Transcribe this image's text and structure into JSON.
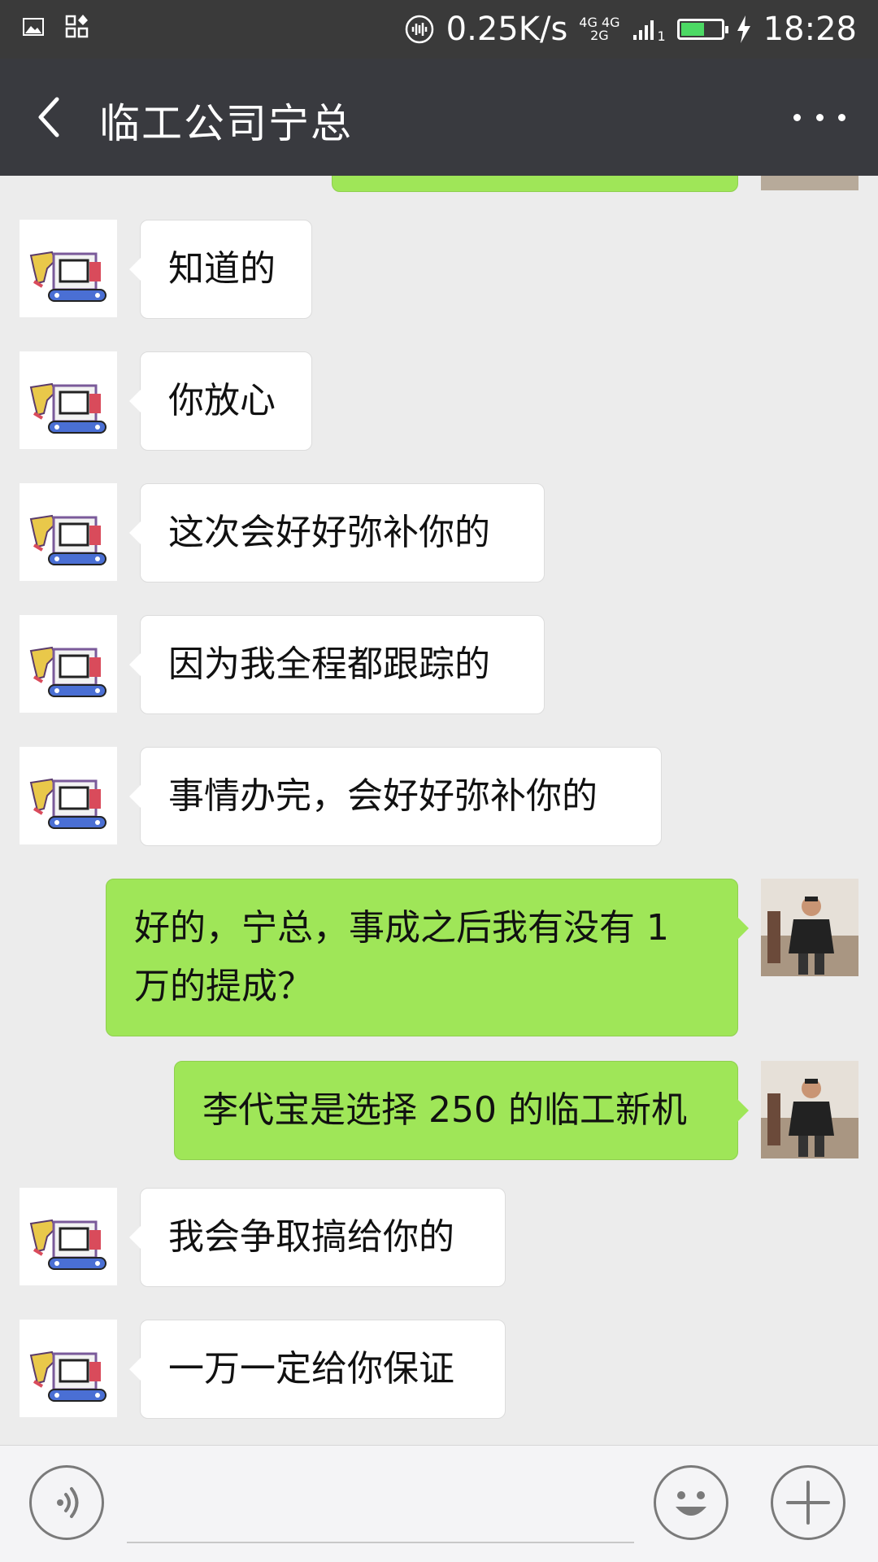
{
  "status_bar": {
    "net_speed": "0.25K/s",
    "network_top": "4G 4G",
    "network_bottom": "2G",
    "sim": "1",
    "time": "18:28",
    "battery_level": 0.55,
    "icons": [
      "image-icon",
      "apps-icon",
      "hd-voice-icon",
      "signal-icon",
      "battery-icon",
      "charging-icon"
    ]
  },
  "header": {
    "title": "临工公司宁总",
    "back_icon": "chevron-left-icon",
    "more_icon": "more-dots-icon"
  },
  "messages": [
    {
      "side": "in",
      "text": "知道的"
    },
    {
      "side": "in",
      "text": "你放心"
    },
    {
      "side": "in",
      "text": "这次会好好弥补你的"
    },
    {
      "side": "in",
      "text": "因为我全程都跟踪的"
    },
    {
      "side": "in",
      "text": "事情办完，会好好弥补你的"
    },
    {
      "side": "out",
      "text": "好的，宁总，事成之后我有没有 1 万的提成？"
    },
    {
      "side": "out",
      "text": "李代宝是选择 250 的临工新机"
    },
    {
      "side": "in",
      "text": "我会争取搞给你的"
    },
    {
      "side": "in",
      "text": "一万一定给你保证"
    }
  ],
  "input_bar": {
    "voice_icon": "voice-icon",
    "emoji_icon": "emoji-icon",
    "plus_icon": "plus-icon",
    "text_value": ""
  },
  "colors": {
    "status_bar": "#3a3a3a",
    "title_bar": "#393a3f",
    "chat_bg": "#ececec",
    "bubble_out": "#9fe658",
    "bubble_in": "#ffffff"
  }
}
